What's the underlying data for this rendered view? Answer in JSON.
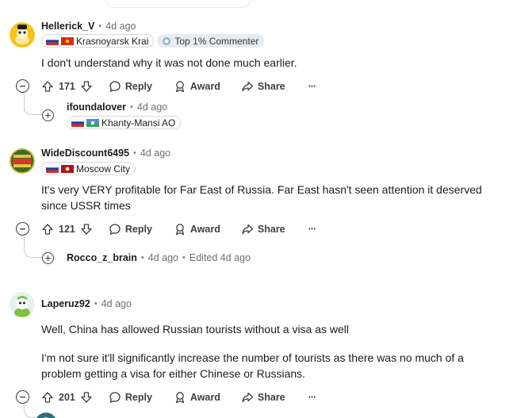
{
  "comments": [
    {
      "user": "Hellerick_V",
      "time": "4d ago",
      "flair": "Krasnoyarsk Krai",
      "badge": "Top 1% Commenter",
      "body": "I don't understand why it was not done much earlier.",
      "votes": "171",
      "reply": "Reply",
      "award": "Award",
      "share": "Share",
      "more": "···",
      "child": {
        "user": "ifoundalover",
        "time": "4d ago",
        "flair": "Khanty-Mansi AO"
      }
    },
    {
      "user": "WideDiscount6495",
      "time": "4d ago",
      "flair": "Moscow City",
      "body": "It's very VERY profitable for Far East of Russia. Far East hasn't seen attention it deserved since USSR times",
      "votes": "121",
      "reply": "Reply",
      "award": "Award",
      "share": "Share",
      "more": "···",
      "child": {
        "user": "Rocco_z_brain",
        "time": "4d ago",
        "edited": "Edited 4d ago"
      }
    },
    {
      "user": "Laperuz92",
      "time": "4d ago",
      "body1": "Well, China has allowed Russian tourists without a visa as well",
      "body2": "I'm not sure it'll significantly increase the number of tourists as there was no much of a problem getting a visa for either Chinese or Russians.",
      "votes": "201",
      "reply": "Reply",
      "award": "Award",
      "share": "Share",
      "more": "···"
    }
  ],
  "icons": [
    "collapse-icon",
    "upvote-icon",
    "downvote-icon",
    "reply-icon",
    "award-icon",
    "share-icon",
    "more-icon",
    "expand-icon",
    "russia-flag-icon",
    "top-commenter-icon"
  ]
}
